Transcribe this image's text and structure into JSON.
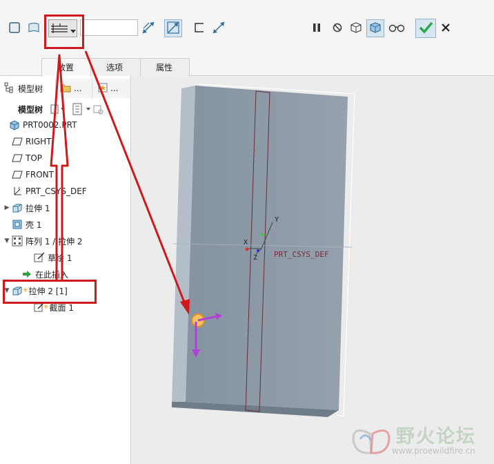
{
  "dashboard": {
    "depth_value": "",
    "tabs": [
      {
        "label": "放置"
      },
      {
        "label": "选项"
      },
      {
        "label": "属性"
      }
    ]
  },
  "panel": {
    "tab_model_tree": "模型树",
    "tab_2_ellipsis": "...",
    "tab_3_ellipsis": "...",
    "tree_label": "模型树"
  },
  "tree": {
    "items": [
      {
        "label": "PRT0002.PRT",
        "icon": "part-icon"
      },
      {
        "label": "RIGHT",
        "icon": "datum-plane-icon"
      },
      {
        "label": "TOP",
        "icon": "datum-plane-icon"
      },
      {
        "label": "FRONT",
        "icon": "datum-plane-icon"
      },
      {
        "label": "PRT_CSYS_DEF",
        "icon": "csys-icon"
      },
      {
        "label": "拉伸 1",
        "icon": "extrude-icon"
      },
      {
        "label": "壳 1",
        "icon": "shell-icon"
      },
      {
        "label": "阵列 1 / 拉伸 2",
        "icon": "pattern-icon"
      },
      {
        "label": "草绘 1",
        "icon": "sketch-icon"
      },
      {
        "label": "在此插入",
        "icon": "insert-arrow-icon"
      },
      {
        "label": "拉伸 2 [1]",
        "icon": "extrude-icon"
      },
      {
        "label": "截面 1",
        "icon": "sketch-icon"
      }
    ]
  },
  "viewport": {
    "csys_label": "PRT_CSYS_DEF",
    "axis_x": "X",
    "axis_y": "Y",
    "axis_z": "Z"
  },
  "watermark": {
    "title": "野火论坛",
    "url": "www.proewildfire.cn"
  },
  "colors": {
    "annotation_red": "#d0181c",
    "ok_green": "#2aa84a",
    "handle_purple": "#b040d8",
    "part_gray": "#8d99a6"
  }
}
